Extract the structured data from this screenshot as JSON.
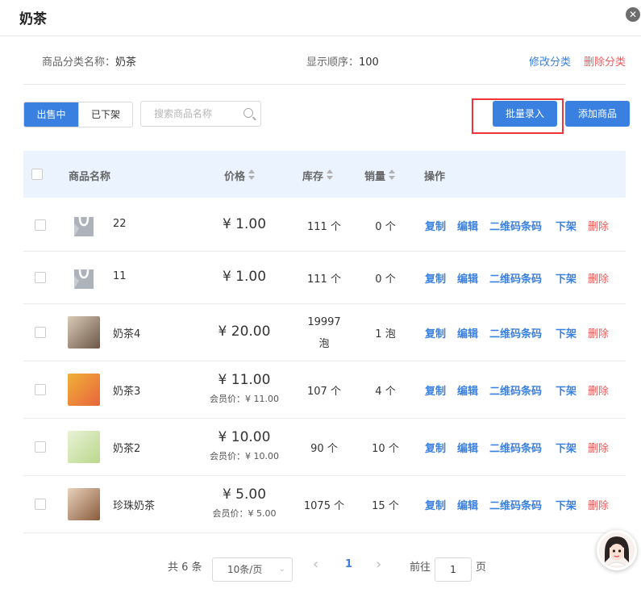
{
  "dialog": {
    "title": "奶茶",
    "close_glyph": "✕"
  },
  "meta": {
    "category_label": "商品分类名称：",
    "category_value": "奶茶",
    "order_label": "显示顺序：",
    "order_value": "100",
    "edit_category": "修改分类",
    "delete_category": "删除分类"
  },
  "tabs": {
    "on_sale": "出售中",
    "off_shelf": "已下架"
  },
  "search": {
    "placeholder": "搜索商品名称"
  },
  "toolbar": {
    "batch_import": "批量录入",
    "add_product": "添加商品"
  },
  "table": {
    "headers": {
      "name": "商品名称",
      "price": "价格",
      "stock": "库存",
      "sales": "销量",
      "ops": "操作"
    },
    "ops": {
      "copy": "复制",
      "edit": "编辑",
      "qrcode": "二维码条码",
      "off": "下架",
      "delete": "删除"
    },
    "rows": [
      {
        "name": "22",
        "price": "¥ 1.00",
        "member": "",
        "stock": "111 个",
        "stock2": "",
        "sales": "0 个",
        "thumb": "placeholder-bag-icon"
      },
      {
        "name": "11",
        "price": "¥ 1.00",
        "member": "",
        "stock": "111 个",
        "stock2": "",
        "sales": "0 个",
        "thumb": "placeholder-bag-icon"
      },
      {
        "name": "奶茶4",
        "price": "¥ 20.00",
        "member": "",
        "stock": "19997",
        "stock2": "泡",
        "sales": "1 泡",
        "thumb": "milk-tea-photo"
      },
      {
        "name": "奶茶3",
        "price": "¥ 11.00",
        "member": "会员价：¥ 11.00",
        "stock": "107 个",
        "stock2": "",
        "sales": "4 个",
        "thumb": "fruit-tea-photo"
      },
      {
        "name": "奶茶2",
        "price": "¥ 10.00",
        "member": "会员价：¥ 10.00",
        "stock": "90 个",
        "stock2": "",
        "sales": "10 个",
        "thumb": "green-tea-photo"
      },
      {
        "name": "珍珠奶茶",
        "price": "¥ 5.00",
        "member": "会员价：¥ 5.00",
        "stock": "1075 个",
        "stock2": "",
        "sales": "15 个",
        "thumb": "pearl-tea-photo"
      }
    ]
  },
  "pagination": {
    "total": "共 6 条",
    "page_size": "10条/页",
    "prev": "‹",
    "current": "1",
    "next": "›",
    "goto_label": "前往",
    "goto_value": "1",
    "page_unit": "页"
  },
  "colors": {
    "primary": "#3a80e0",
    "danger": "#f15a5a",
    "highlight": "#f0343a"
  }
}
